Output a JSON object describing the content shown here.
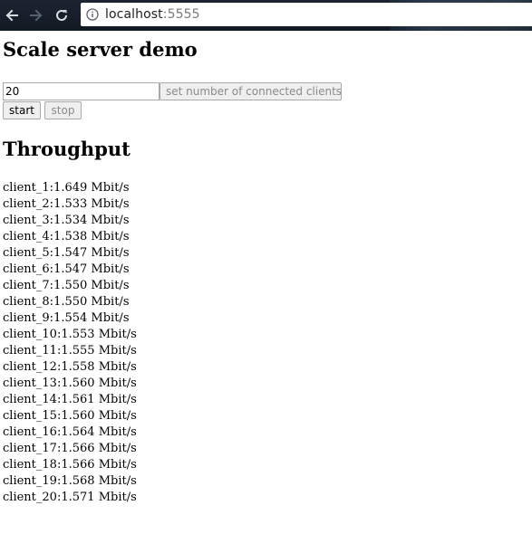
{
  "browser": {
    "url_host": "localhost",
    "url_port": ":5555",
    "icons": {
      "back": "arrow-left-icon",
      "forward": "arrow-right-icon",
      "reload": "reload-icon",
      "info": "info-icon"
    }
  },
  "page": {
    "title": "Scale server demo",
    "clients_input_value": "20",
    "set_clients_label": "set number of connected clients",
    "start_label": "start",
    "stop_label": "stop",
    "throughput_heading": "Throughput"
  },
  "throughput": [
    {
      "client": "client_1",
      "value": "1.649",
      "unit": "Mbit/s"
    },
    {
      "client": "client_2",
      "value": "1.533",
      "unit": "Mbit/s"
    },
    {
      "client": "client_3",
      "value": "1.534",
      "unit": "Mbit/s"
    },
    {
      "client": "client_4",
      "value": "1.538",
      "unit": "Mbit/s"
    },
    {
      "client": "client_5",
      "value": "1.547",
      "unit": "Mbit/s"
    },
    {
      "client": "client_6",
      "value": "1.547",
      "unit": "Mbit/s"
    },
    {
      "client": "client_7",
      "value": "1.550",
      "unit": "Mbit/s"
    },
    {
      "client": "client_8",
      "value": "1.550",
      "unit": "Mbit/s"
    },
    {
      "client": "client_9",
      "value": "1.554",
      "unit": "Mbit/s"
    },
    {
      "client": "client_10",
      "value": "1.553",
      "unit": "Mbit/s"
    },
    {
      "client": "client_11",
      "value": "1.555",
      "unit": "Mbit/s"
    },
    {
      "client": "client_12",
      "value": "1.558",
      "unit": "Mbit/s"
    },
    {
      "client": "client_13",
      "value": "1.560",
      "unit": "Mbit/s"
    },
    {
      "client": "client_14",
      "value": "1.561",
      "unit": "Mbit/s"
    },
    {
      "client": "client_15",
      "value": "1.560",
      "unit": "Mbit/s"
    },
    {
      "client": "client_16",
      "value": "1.564",
      "unit": "Mbit/s"
    },
    {
      "client": "client_17",
      "value": "1.566",
      "unit": "Mbit/s"
    },
    {
      "client": "client_18",
      "value": "1.566",
      "unit": "Mbit/s"
    },
    {
      "client": "client_19",
      "value": "1.568",
      "unit": "Mbit/s"
    },
    {
      "client": "client_20",
      "value": "1.571",
      "unit": "Mbit/s"
    }
  ]
}
